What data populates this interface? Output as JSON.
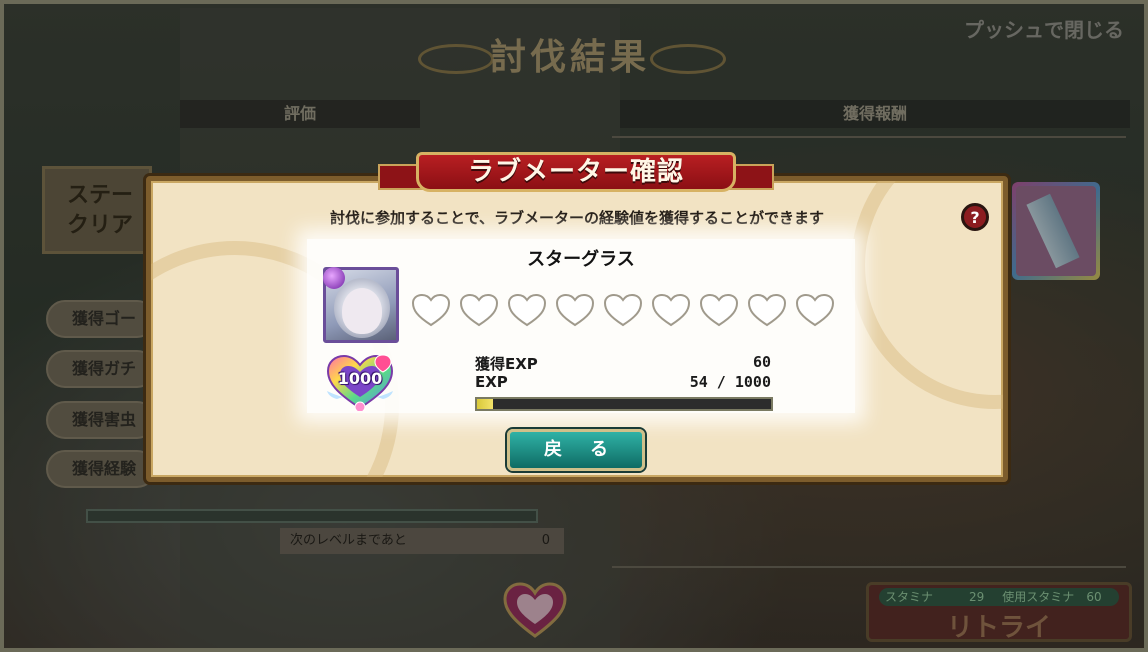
{
  "background": {
    "title": "討伐結果",
    "close_hint": "プッシュで閉じる",
    "header_left": "評価",
    "header_right": "獲得報酬",
    "stage_label": "ステー クリア",
    "reward_pills": [
      "獲得ゴー",
      "獲得ガチ",
      "獲得害虫",
      "獲得経験"
    ],
    "next_level_label": "次のレベルまであと",
    "next_level_value": "0",
    "stamina_label": "スタミナ",
    "stamina_value": "29",
    "used_stamina_label": "使用スタミナ",
    "used_stamina_value": "60",
    "retry_label": "リトライ"
  },
  "dialog": {
    "title": "ラブメーター確認",
    "description": "討伐に参加することで、ラブメーターの経験値を獲得することができます",
    "help_label": "?",
    "character_name": "スターグラス",
    "love_level": "1000",
    "hearts_total": 9,
    "hearts_filled": 0,
    "gained_exp_label": "獲得EXP",
    "gained_exp_value": "60",
    "exp_label": "EXP",
    "exp_value": "54 / 1000",
    "exp_fraction": 0.054,
    "back_button": "戻る"
  },
  "colors": {
    "ribbon_red": "#b81f22",
    "button_teal": "#1f8f86",
    "gold": "#d7b263"
  }
}
